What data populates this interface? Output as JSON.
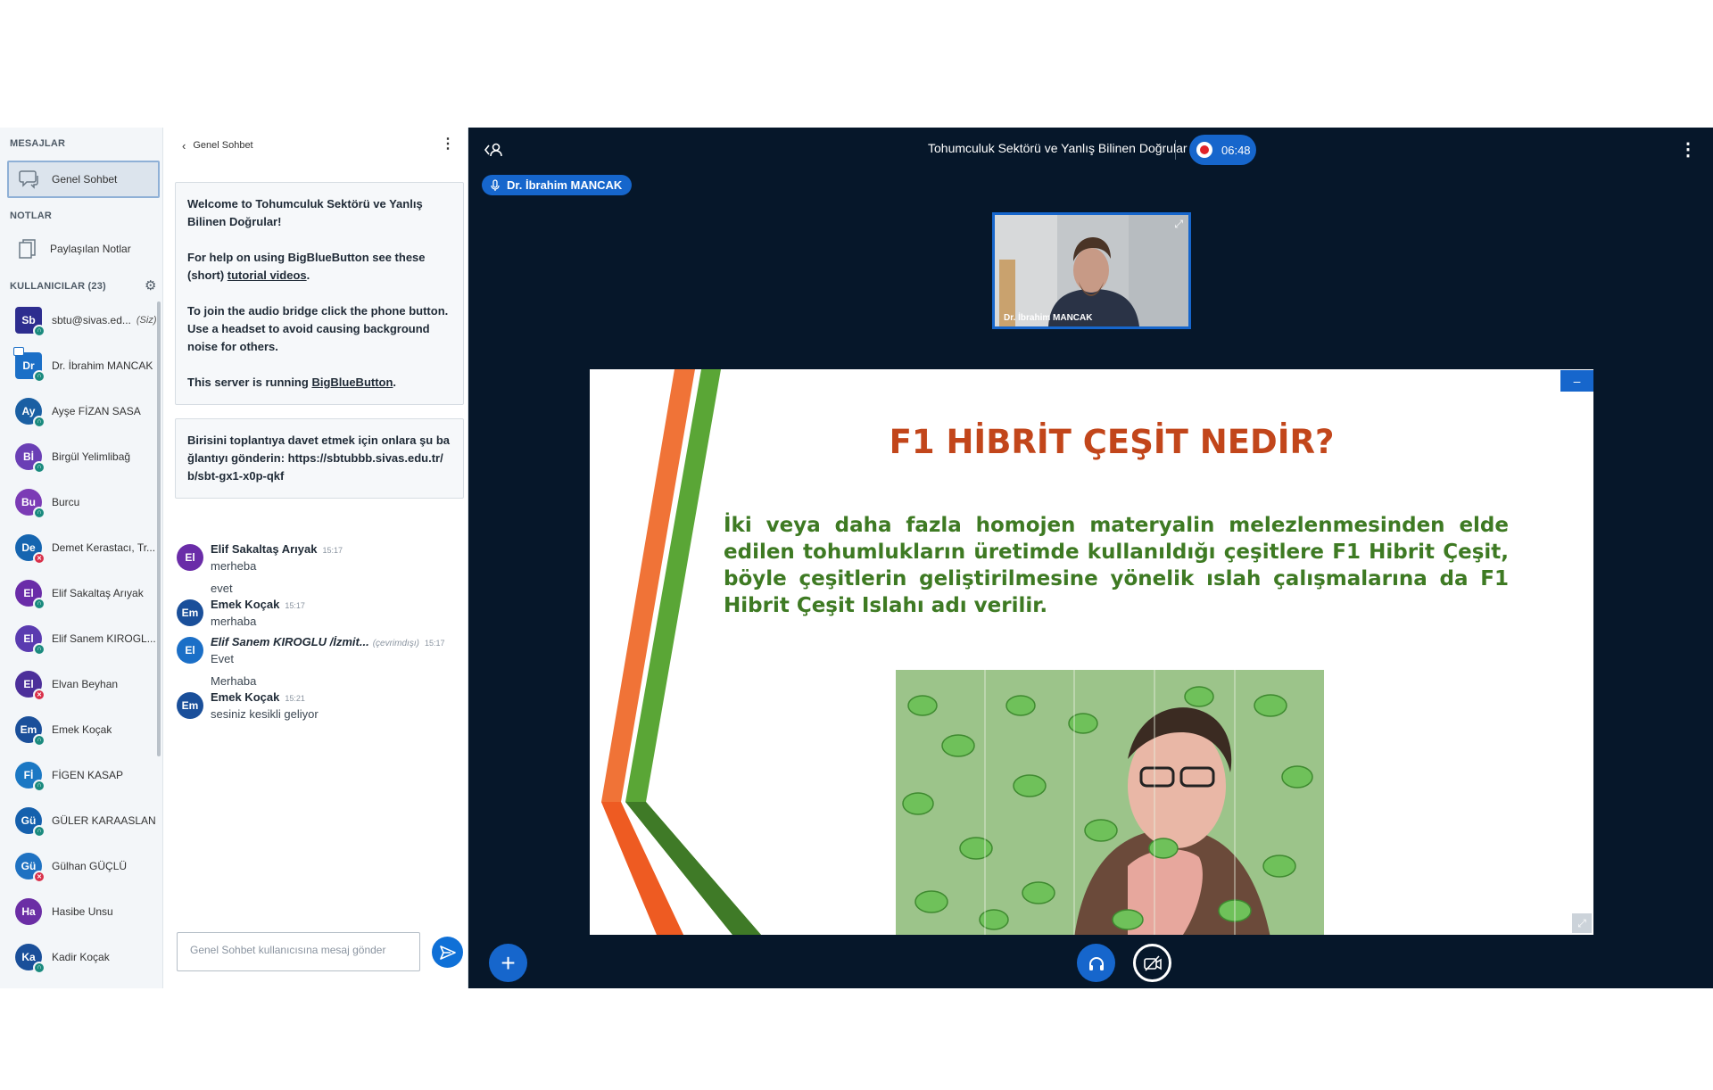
{
  "sidebar": {
    "messages_title": "MESAJLAR",
    "public_chat": "Genel Sohbet",
    "notes_title": "NOTLAR",
    "shared_notes": "Paylaşılan Notlar",
    "users_title": "KULLANICILAR (23)",
    "users": [
      {
        "initials": "Sb",
        "name": "sbtu@sivas.ed...",
        "you": "(Siz)",
        "color": "#2d2d8f",
        "status": "audio",
        "square": true
      },
      {
        "initials": "Dr",
        "name": "Dr. İbrahim MANCAK",
        "color": "#1b6fc7",
        "status": "audio",
        "square": true,
        "presenter": true
      },
      {
        "initials": "Ay",
        "name": "Ayşe FİZAN SASA",
        "color": "#1a5fa3",
        "status": "audio"
      },
      {
        "initials": "Bİ",
        "name": "Birgül Yelimlibağ",
        "color": "#6a3fb5",
        "status": "audio"
      },
      {
        "initials": "Bu",
        "name": "Burcu",
        "color": "#7b3bb5",
        "status": "audio"
      },
      {
        "initials": "De",
        "name": "Demet Kerastacı, Tr...",
        "color": "#1565b0",
        "status": "muted"
      },
      {
        "initials": "El",
        "name": "Elif Sakaltaş Arıyak",
        "color": "#6a2ca8",
        "status": "audio"
      },
      {
        "initials": "El",
        "name": "Elif Sanem KIROGL...",
        "color": "#5a3bb0",
        "status": "audio"
      },
      {
        "initials": "El",
        "name": "Elvan Beyhan",
        "color": "#4c2f9a",
        "status": "muted"
      },
      {
        "initials": "Em",
        "name": "Emek Koçak",
        "color": "#1a4f9a",
        "status": "audio"
      },
      {
        "initials": "Fİ",
        "name": "FİGEN KASAP",
        "color": "#1b78c4",
        "status": "audio"
      },
      {
        "initials": "Gü",
        "name": "GÜLER KARAASLAN",
        "color": "#1560ad",
        "status": "audio"
      },
      {
        "initials": "Gü",
        "name": "Gülhan GÜÇLÜ",
        "color": "#1f72c2",
        "status": "muted"
      },
      {
        "initials": "Ha",
        "name": "Hasibe Unsu",
        "color": "#6b2ea5",
        "status": "none"
      },
      {
        "initials": "Ka",
        "name": "Kadir Koçak",
        "color": "#1a4f9a",
        "status": "audio"
      }
    ]
  },
  "chat": {
    "back_label": "Genel Sohbet",
    "welcome": {
      "line1": "Welcome to Tohumculuk Sektörü ve Yanlış Bilinen Doğrular!",
      "line2a": "For help on using BigBlueButton see these (short) ",
      "line2_link": "tutorial videos",
      "line2b": ".",
      "line3": "To join the audio bridge click the phone button. Use a headset to avoid causing background noise for others.",
      "line4a": "This server is running ",
      "line4_link": "BigBlueButton",
      "line4b": "."
    },
    "invite": "Birisini toplantıya davet etmek için onlara şu bağlantıyı gönderin: https://sbtubbb.sivas.edu.tr/b/sbt-gx1-x0p-qkf",
    "messages": [
      {
        "initials": "El",
        "color": "#6a2ca8",
        "name": "Elif Sakaltaş Arıyak",
        "time": "15:17",
        "lines": [
          "merheba",
          "evet"
        ]
      },
      {
        "initials": "Em",
        "color": "#1a4f9a",
        "name": "Emek Koçak",
        "time": "15:17",
        "lines": [
          "merhaba"
        ]
      },
      {
        "initials": "El",
        "color": "#1b6fc7",
        "name": "Elif Sanem KIROGLU /İzmit...",
        "offline": "(çevrimdışı)",
        "time": "15:17",
        "lines": [
          "Evet",
          "Merhaba"
        ]
      },
      {
        "initials": "Em",
        "color": "#1a4f9a",
        "name": "Emek Koçak",
        "time": "15:21",
        "lines": [
          "sesiniz kesikli geliyor"
        ]
      }
    ],
    "input_placeholder": "Genel Sohbet kullanıcısına mesaj gönder"
  },
  "main": {
    "meeting_title": "Tohumculuk Sektörü ve Yanlış Bilinen Doğrular",
    "recording_time": "06:48",
    "talker": "Dr. İbrahim MANCAK",
    "webcam_name": "Dr. İbrahim MANCAK",
    "slide": {
      "title": "F1 HİBRİT ÇEŞİT NEDİR?",
      "body": "İki veya daha fazla homojen materyalin melezlenmesinden elde edilen tohumlukların üretimde kullanıldığı çeşitlere F1 Hibrit Çeşit, böyle çeşitlerin geliştirilmesine yönelik ıslah çalışmalarına da F1 Hibrit Çeşit Islahı adı verilir."
    },
    "minimize_label": "–",
    "add_label": "+"
  },
  "colors": {
    "accent": "#1666cc",
    "main_bg": "#06172a",
    "slide_title": "#c2461b",
    "slide_body": "#3e7a23",
    "audio_status": "#1a8a7e",
    "muted_status": "#d9304a"
  }
}
